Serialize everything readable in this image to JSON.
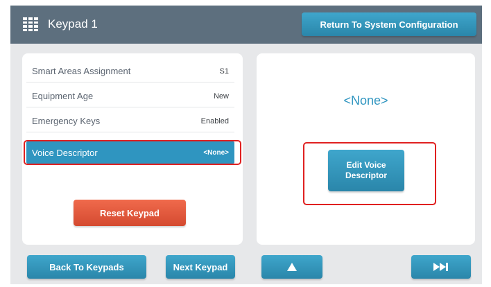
{
  "header": {
    "title": "Keypad 1",
    "return_label": "Return To System Configuration",
    "icon": "keypad-grid-icon"
  },
  "settings": {
    "rows": [
      {
        "label": "Smart Areas Assignment",
        "value": "S1",
        "selected": false
      },
      {
        "label": "Equipment Age",
        "value": "New",
        "selected": false
      },
      {
        "label": "Emergency Keys",
        "value": "Enabled",
        "selected": false
      },
      {
        "label": "Voice Descriptor",
        "value": "<None>",
        "selected": true
      }
    ],
    "reset_label": "Reset Keypad"
  },
  "detail": {
    "value": "<None>",
    "edit_label": "Edit Voice Descriptor"
  },
  "footer": {
    "back_label": "Back To Keypads",
    "next_label": "Next Keypad",
    "up_icon": "triangle-up-icon",
    "skip_icon": "skip-forward-icon"
  },
  "colors": {
    "header": "#5d6f7e",
    "accent": "#2f95c0",
    "reset": "#e0573b",
    "highlight": "#e02020"
  }
}
